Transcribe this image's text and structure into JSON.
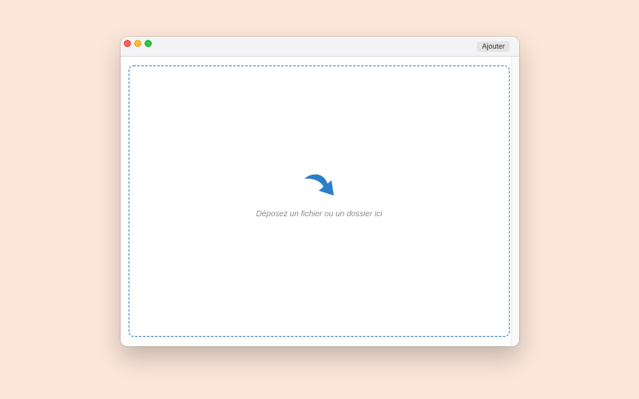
{
  "window": {
    "traffic_lights": {
      "close_color": "#fe5f57",
      "minimize_color": "#febc2e",
      "zoom_color": "#28c840"
    },
    "toolbar": {
      "add_label": "Ajouter"
    }
  },
  "dropzone": {
    "icon": "curved-arrow-down-icon",
    "message": "Déposez un fichier ou un dossier ici",
    "accent_color": "#2b7fc9"
  },
  "colors": {
    "background": "#fbe6d9",
    "accent": "#2b7fc9"
  }
}
